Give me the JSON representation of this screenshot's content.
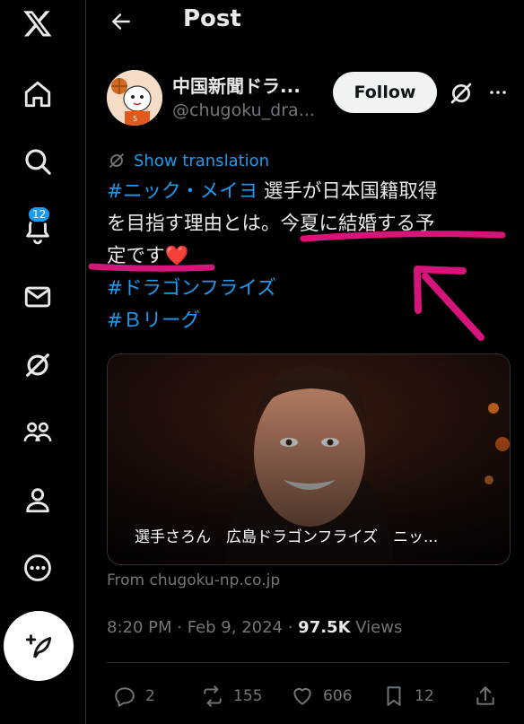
{
  "sidebar": {
    "notifications_badge": "12"
  },
  "header": {
    "title": "Post"
  },
  "author": {
    "name": "中国新聞ドラ...",
    "handle": "@chugoku_dra..."
  },
  "follow_label": "Follow",
  "translate_label": "Show translation",
  "tweet": {
    "hashtag1": "#ニック・メイヨ",
    "line1_rest": " 選手が日本国籍取得",
    "line2": "を目指す理由とは。今夏に結婚する予",
    "line3": "定です",
    "heart": "❤️",
    "hashtag2": "#ドラゴンフライズ",
    "hashtag3": "#Ｂリーグ"
  },
  "card": {
    "caption": "選手さろん　広島ドラゴンフライズ　ニッ...",
    "source": "From chugoku-np.co.jp"
  },
  "meta": {
    "time": "8:20 PM",
    "sep": " · ",
    "date": "Feb 9, 2024",
    "views_count": "97.5K",
    "views_label": "Views"
  },
  "actions": {
    "replies": "2",
    "reposts": "155",
    "likes": "606",
    "bookmarks": "12"
  },
  "colors": {
    "accent": "#1d9bf0",
    "annotation": "#d6157a"
  }
}
